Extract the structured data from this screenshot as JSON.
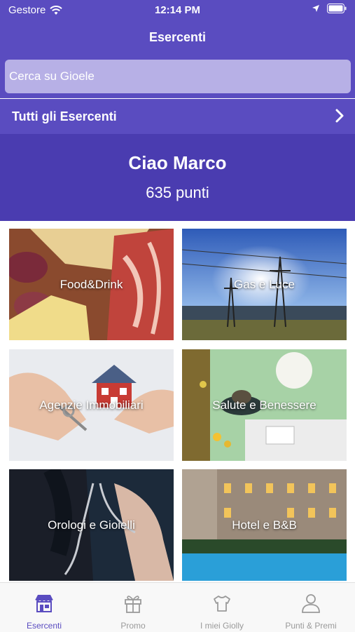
{
  "status_bar": {
    "carrier": "Gestore",
    "time": "12:14 PM"
  },
  "nav": {
    "title": "Esercenti"
  },
  "search": {
    "placeholder": "Cerca su Gioele"
  },
  "all_merchants": {
    "label": "Tutti gli Esercenti"
  },
  "greeting": {
    "name": "Ciao Marco",
    "points": "635 punti"
  },
  "categories": [
    {
      "label": "Food&Drink"
    },
    {
      "label": "Gas e Luce"
    },
    {
      "label": "Agenzie Immobiliari"
    },
    {
      "label": "Salute e Benessere"
    },
    {
      "label": "Orologi e Gioielli"
    },
    {
      "label": "Hotel e B&B"
    }
  ],
  "tabs": [
    {
      "label": "Esercenti",
      "icon": "shop-icon"
    },
    {
      "label": "Promo",
      "icon": "gift-icon"
    },
    {
      "label": "I miei Giolly",
      "icon": "shirt-icon"
    },
    {
      "label": "Punti & Premi",
      "icon": "user-icon"
    }
  ],
  "colors": {
    "primary": "#5a4cc0",
    "greeting_bg": "#4a3cb0",
    "search_bg": "#b7b0e6",
    "tab_inactive": "#9a9a9a"
  }
}
